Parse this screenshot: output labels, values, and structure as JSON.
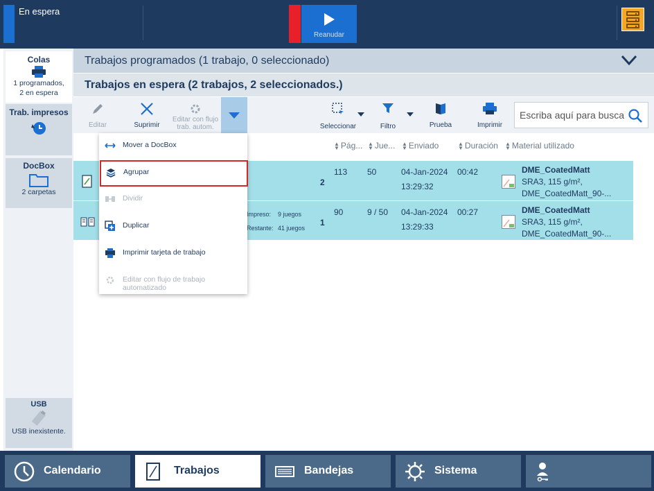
{
  "topbar": {
    "status": "En espera",
    "resume_label": "Reanudar"
  },
  "sidebar": {
    "colas": {
      "title": "Colas",
      "line1": "1 programados,",
      "line2": "2 en espera"
    },
    "trab": {
      "title": "Trab. impresos"
    },
    "docbox": {
      "title": "DocBox",
      "sub": "2 carpetas"
    },
    "usb": {
      "title": "USB",
      "sub": "USB inexistente."
    }
  },
  "main": {
    "scheduled_title": "Trabajos programados (1 trabajo, 0 seleccionado)",
    "hold_title": "Trabajos en espera (2 trabajos, 2 seleccionados.)"
  },
  "toolbar": {
    "edit": "Editar",
    "delete": "Suprimir",
    "edit_flow_1": "Editar con flujo",
    "edit_flow_2": "trab. autom.",
    "select": "Seleccionar",
    "filter": "Filtro",
    "proof": "Prueba",
    "print": "Imprimir",
    "search_placeholder": "Escriba aquí para buscar"
  },
  "columns": {
    "pages": "Pág...",
    "sets": "Jue...",
    "sent": "Enviado",
    "duration": "Duración",
    "media": "Material utilizado"
  },
  "rows": [
    {
      "copies": "2",
      "pages": "113",
      "sets": "50",
      "date": "04-Jan-2024",
      "time": "13:29:32",
      "duration": "00:42",
      "media_name": "DME_CoatedMatt",
      "media_spec": "SRA3, 115 g/m²,",
      "media_sub": "DME_CoatedMatt_90-..."
    },
    {
      "printed_label": "Impreso:",
      "printed_value": "9 juegos",
      "remaining_label": "Restante:",
      "remaining_value": "41 juegos",
      "copies": "1",
      "pages": "90",
      "sets": "9 / 50",
      "date": "04-Jan-2024",
      "time": "13:29:33",
      "duration": "00:27",
      "media_name": "DME_CoatedMatt",
      "media_spec": "SRA3, 115 g/m²,",
      "media_sub": "DME_CoatedMatt_90-..."
    }
  ],
  "menu": {
    "move": "Mover a DocBox",
    "group": "Agrupar",
    "split": "Dividir",
    "duplicate": "Duplicar",
    "ticket": "Imprimir tarjeta de trabajo",
    "edit_flow": "Editar con flujo de trabajo automatizado"
  },
  "bottom_nav": {
    "calendar": "Calendario",
    "jobs": "Trabajos",
    "trays": "Bandejas",
    "system": "Sistema"
  },
  "colors": {
    "navy": "#1e3a5f",
    "accent_blue": "#1a6fd1",
    "row_selected": "#a3dfe8",
    "alert_red": "#e8202a",
    "server_orange": "#f5a623"
  }
}
